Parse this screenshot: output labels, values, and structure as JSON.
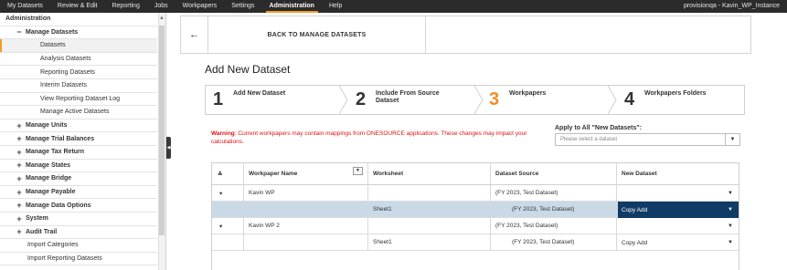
{
  "topnav": {
    "items": [
      {
        "label": "My Datasets"
      },
      {
        "label": "Review & Edit"
      },
      {
        "label": "Reporting"
      },
      {
        "label": "Jobs"
      },
      {
        "label": "Workpapers"
      },
      {
        "label": "Settings"
      },
      {
        "label": "Administration",
        "active": true
      },
      {
        "label": "Help"
      }
    ],
    "user": "provisionqa - Kavin_WP_Instance",
    "accent_color": "#f39b2b"
  },
  "sidebar": {
    "title": "Administration",
    "manage_datasets": {
      "label": "Manage Datasets",
      "toggle": "−",
      "items": [
        {
          "label": "Datasets",
          "selected": true
        },
        {
          "label": "Analysis Datasets"
        },
        {
          "label": "Reporting Datasets"
        },
        {
          "label": "Interim Datasets"
        },
        {
          "label": "View Reporting Dataset Log"
        },
        {
          "label": "Manage Active Datasets"
        }
      ]
    },
    "sections": [
      {
        "label": "Manage Units",
        "toggle": "+"
      },
      {
        "label": "Manage Trial Balances",
        "toggle": "+"
      },
      {
        "label": "Manage Tax Return",
        "toggle": "+"
      },
      {
        "label": "Manage States",
        "toggle": "+"
      },
      {
        "label": "Manage Bridge",
        "toggle": "+"
      },
      {
        "label": "Manage Payable",
        "toggle": "+"
      },
      {
        "label": "Manage Data Options",
        "toggle": "+"
      },
      {
        "label": "System",
        "toggle": "+"
      },
      {
        "label": "Audit Trail",
        "toggle": "+"
      }
    ],
    "extra_items": [
      {
        "label": "Import Categories"
      },
      {
        "label": "Import Reporting Datasets"
      }
    ]
  },
  "backbar": {
    "arrow": "←",
    "label": "BACK TO MANAGE DATASETS"
  },
  "page_title": "Add New Dataset",
  "wizard": {
    "steps": [
      {
        "number": "1",
        "label": "Add New Dataset",
        "active": false
      },
      {
        "number": "2",
        "label": "Include From Source Dataset",
        "active": false
      },
      {
        "number": "3",
        "label": "Workpapers",
        "active": true
      },
      {
        "number": "4",
        "label": "Workpapers Folders",
        "active": false
      }
    ],
    "active_color": "#f38b24"
  },
  "warning": {
    "prefix": "Warning",
    "text": ": Current workpapers may contain mappings from ONESOURCE applications. These changes may impact your calculations."
  },
  "apply_all": {
    "label": "Apply to All \"New Datasets\":",
    "placeholder": "Please select a dataset"
  },
  "table": {
    "headers": {
      "expand": "≚",
      "workpaper_name": "Workpaper Name",
      "worksheet": "Worksheet",
      "dataset_source": "Dataset Source",
      "new_dataset": "New Dataset"
    },
    "rows": [
      {
        "type": "parent",
        "expander": "▾",
        "workpaper": "Kavin WP",
        "worksheet": "",
        "source": "(FY 2023, Test Dataset)",
        "new_dataset": "",
        "selected": false
      },
      {
        "type": "child",
        "expander": "",
        "workpaper": "",
        "worksheet": "Sheet1",
        "source": "(FY 2023, Test Dataset)",
        "new_dataset": "Copy Add",
        "selected": true
      },
      {
        "type": "parent",
        "expander": "▾",
        "workpaper": "Kavin WP 2",
        "worksheet": "",
        "source": "(FY 2023, Test Dataset)",
        "new_dataset": "",
        "selected": false
      },
      {
        "type": "child",
        "expander": "",
        "workpaper": "",
        "worksheet": "Sheet1",
        "source": "(FY 2023, Test Dataset)",
        "new_dataset": "Copy Add",
        "selected": false
      }
    ],
    "selected_color": "#c9d9e6",
    "dark_cell_color": "#0f3b66"
  }
}
